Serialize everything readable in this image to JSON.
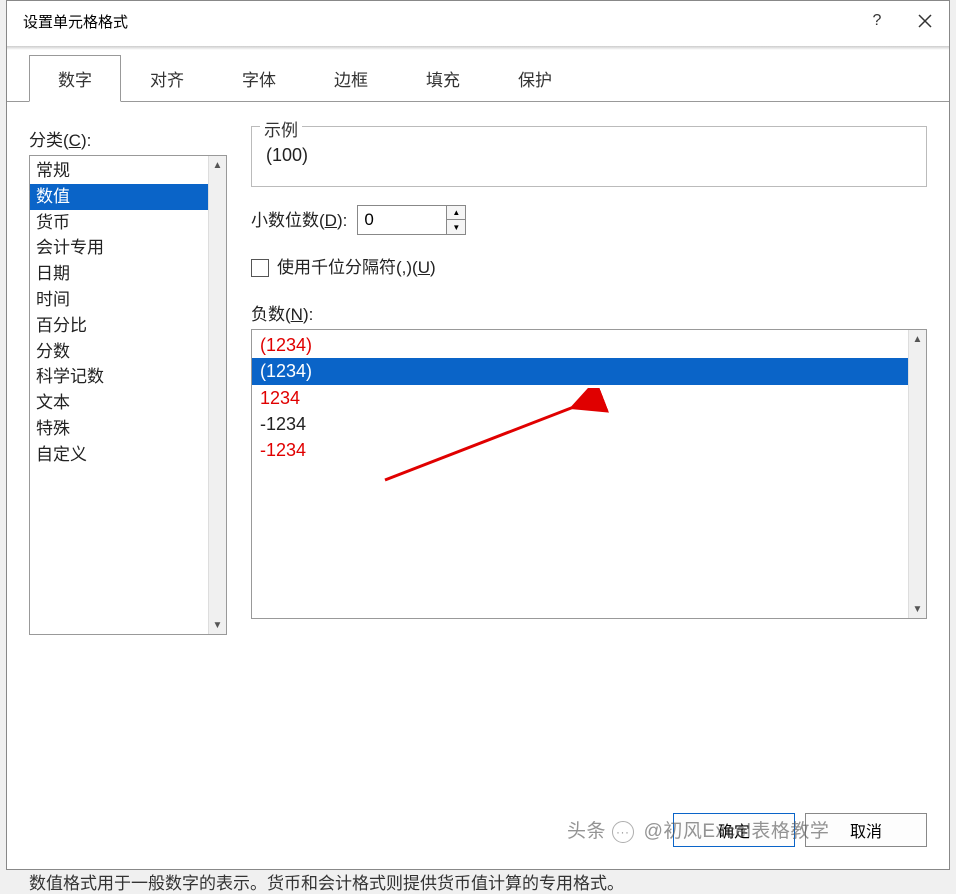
{
  "titlebar": {
    "title": "设置单元格格式"
  },
  "tabs": [
    {
      "label": "数字",
      "active": true
    },
    {
      "label": "对齐",
      "active": false
    },
    {
      "label": "字体",
      "active": false
    },
    {
      "label": "边框",
      "active": false
    },
    {
      "label": "填充",
      "active": false
    },
    {
      "label": "保护",
      "active": false
    }
  ],
  "category": {
    "label_prefix": "分类(",
    "label_key": "C",
    "label_suffix": "):",
    "items": [
      "常规",
      "数值",
      "货币",
      "会计专用",
      "日期",
      "时间",
      "百分比",
      "分数",
      "科学记数",
      "文本",
      "特殊",
      "自定义"
    ],
    "selected_index": 1
  },
  "sample": {
    "legend": "示例",
    "value": "(100)"
  },
  "decimals": {
    "label_prefix": "小数位数(",
    "label_key": "D",
    "label_suffix": "):",
    "value": "0"
  },
  "thousands": {
    "label_prefix": "使用千位分隔符(,)(",
    "label_key": "U",
    "label_suffix": ")",
    "checked": false
  },
  "negative": {
    "label_prefix": "负数(",
    "label_key": "N",
    "label_suffix": "):",
    "items": [
      {
        "text": "(1234)",
        "color": "red"
      },
      {
        "text": "(1234)",
        "color": "selected"
      },
      {
        "text": "1234",
        "color": "red"
      },
      {
        "text": "-1234",
        "color": "black"
      },
      {
        "text": "-1234",
        "color": "red"
      }
    ],
    "selected_index": 1
  },
  "description": "数值格式用于一般数字的表示。货币和会计格式则提供货币值计算的专用格式。",
  "buttons": {
    "ok": "确定",
    "cancel": "取消"
  },
  "watermark": {
    "prefix": "头条",
    "text": "@初风Excel表格教学"
  }
}
